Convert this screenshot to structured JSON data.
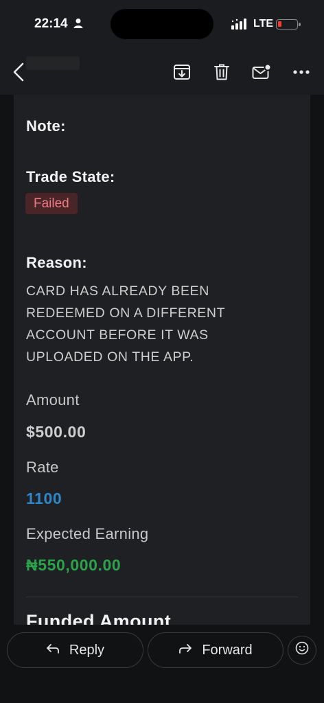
{
  "status_bar": {
    "time": "22:14",
    "network": "LTE"
  },
  "toolbar": {
    "icons": [
      "back-chevron-icon",
      "archive-icon",
      "trash-icon",
      "mail-unread-icon",
      "more-icon"
    ]
  },
  "email": {
    "note_label": "Note:",
    "trade_state_label": "Trade State:",
    "trade_state_value": "Failed",
    "reason_label": "Reason:",
    "reason_lines": [
      "CARD HAS ALREADY BEEN",
      "REDEEMED ON A DIFFERENT",
      "ACCOUNT BEFORE IT WAS",
      "UPLOADED ON THE APP."
    ],
    "amount_label": "Amount",
    "amount_value": "$500.00",
    "rate_label": "Rate",
    "rate_value": "1100",
    "earning_label": "Expected Earning",
    "earning_value": "₦550,000.00",
    "funded_label": "Funded Amount"
  },
  "actions": {
    "reply_label": "Reply",
    "forward_label": "Forward"
  },
  "colors": {
    "failed_badge_bg": "#4a2528",
    "failed_badge_text": "#f07a82",
    "rate_blue": "#2f86c8",
    "earning_green": "#2aa34a"
  }
}
